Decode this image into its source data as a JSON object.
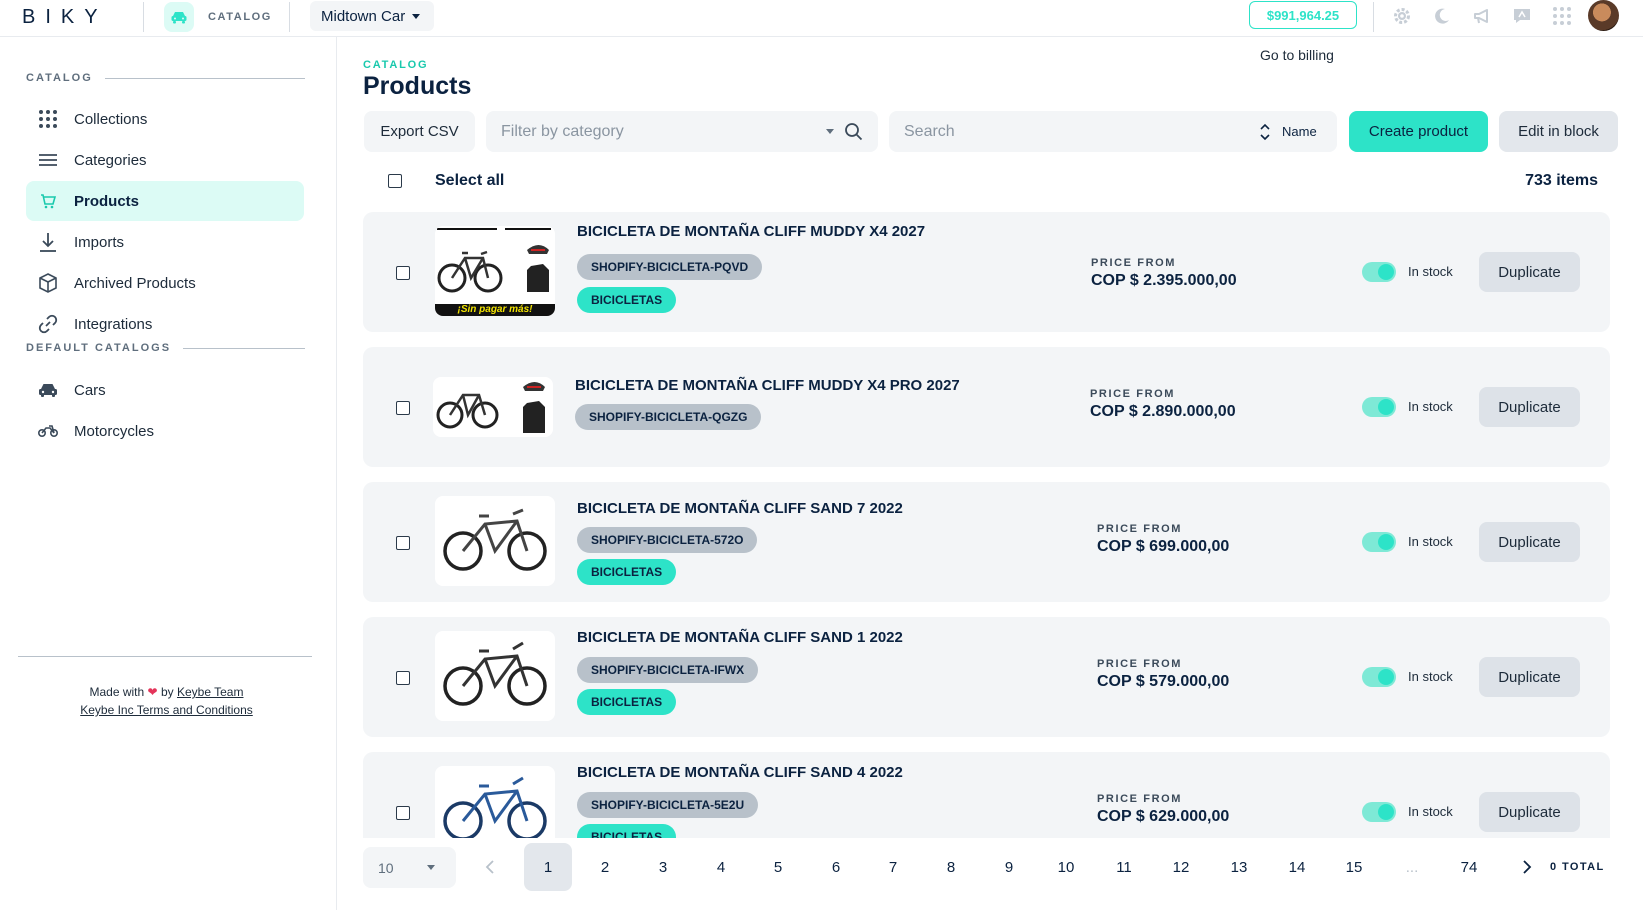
{
  "header": {
    "logo": "BIKY",
    "app_label": "CATALOG",
    "company": "Midtown Car",
    "balance": "$991,964.25",
    "billing_link": "Go to billing",
    "icons": [
      "gear-icon",
      "moon-icon",
      "megaphone-icon",
      "chat-icon",
      "apps-grid-icon"
    ],
    "accent_color": "#2de3c8"
  },
  "sidebar": {
    "section_catalog": "CATALOG",
    "items": [
      {
        "label": "Collections",
        "icon": "grid-dots-icon"
      },
      {
        "label": "Categories",
        "icon": "list-icon"
      },
      {
        "label": "Products",
        "icon": "cart-icon",
        "active": true
      },
      {
        "label": "Imports",
        "icon": "download-icon"
      },
      {
        "label": "Archived Products",
        "icon": "box-icon"
      },
      {
        "label": "Integrations",
        "icon": "link-icon"
      }
    ],
    "section_default": "DEFAULT CATALOGS",
    "default_items": [
      {
        "label": "Cars",
        "icon": "car-icon"
      },
      {
        "label": "Motorcycles",
        "icon": "motorcycle-icon"
      }
    ],
    "footer": {
      "made_with": "Made with",
      "by": "by",
      "team_link": "Keybe Team",
      "terms_link": "Keybe Inc Terms and Conditions"
    }
  },
  "main": {
    "breadcrumb": "CATALOG",
    "title": "Products",
    "toolbar": {
      "export_label": "Export CSV",
      "filter_placeholder": "Filter by category",
      "search_placeholder": "Search",
      "sort_label": "Name",
      "create_label": "Create product",
      "edit_block_label": "Edit in block"
    },
    "select_all_label": "Select all",
    "items_count": "733 items",
    "price_from_label": "PRICE FROM",
    "in_stock_label": "In stock",
    "duplicate_label": "Duplicate",
    "products": [
      {
        "name": "BICICLETA DE MONTAÑA CLIFF MUDDY X4 2027",
        "sku": "SHOPIFY-BICICLETA-PQVD",
        "category": "BICICLETAS",
        "price": "COP $ 2.395.000,00",
        "in_stock": true,
        "thumb_text": "¡Sin pagar más!"
      },
      {
        "name": "BICICLETA DE MONTAÑA CLIFF MUDDY X4 PRO 2027",
        "sku": "SHOPIFY-BICICLETA-QGZG",
        "category": "",
        "price": "COP $ 2.890.000,00",
        "in_stock": true
      },
      {
        "name": "BICICLETA DE MONTAÑA CLIFF SAND 7 2022",
        "sku": "SHOPIFY-BICICLETA-572O",
        "category": "BICICLETAS",
        "price": "COP $ 699.000,00",
        "in_stock": true
      },
      {
        "name": "BICICLETA DE MONTAÑA CLIFF SAND 1 2022",
        "sku": "SHOPIFY-BICICLETA-IFWX",
        "category": "BICICLETAS",
        "price": "COP $ 579.000,00",
        "in_stock": true
      },
      {
        "name": "BICICLETA DE MONTAÑA CLIFF SAND 4 2022",
        "sku": "SHOPIFY-BICICLETA-5E2U",
        "category": "BICICLETAS",
        "price": "COP $ 629.000,00",
        "in_stock": true
      }
    ]
  },
  "pagination": {
    "per_page": "10",
    "pages": [
      "1",
      "2",
      "3",
      "4",
      "5",
      "6",
      "7",
      "8",
      "9",
      "10",
      "11",
      "12",
      "13",
      "14",
      "15"
    ],
    "current": "1",
    "ellipsis": "...",
    "last": "74",
    "total": "0 TOTAL"
  }
}
